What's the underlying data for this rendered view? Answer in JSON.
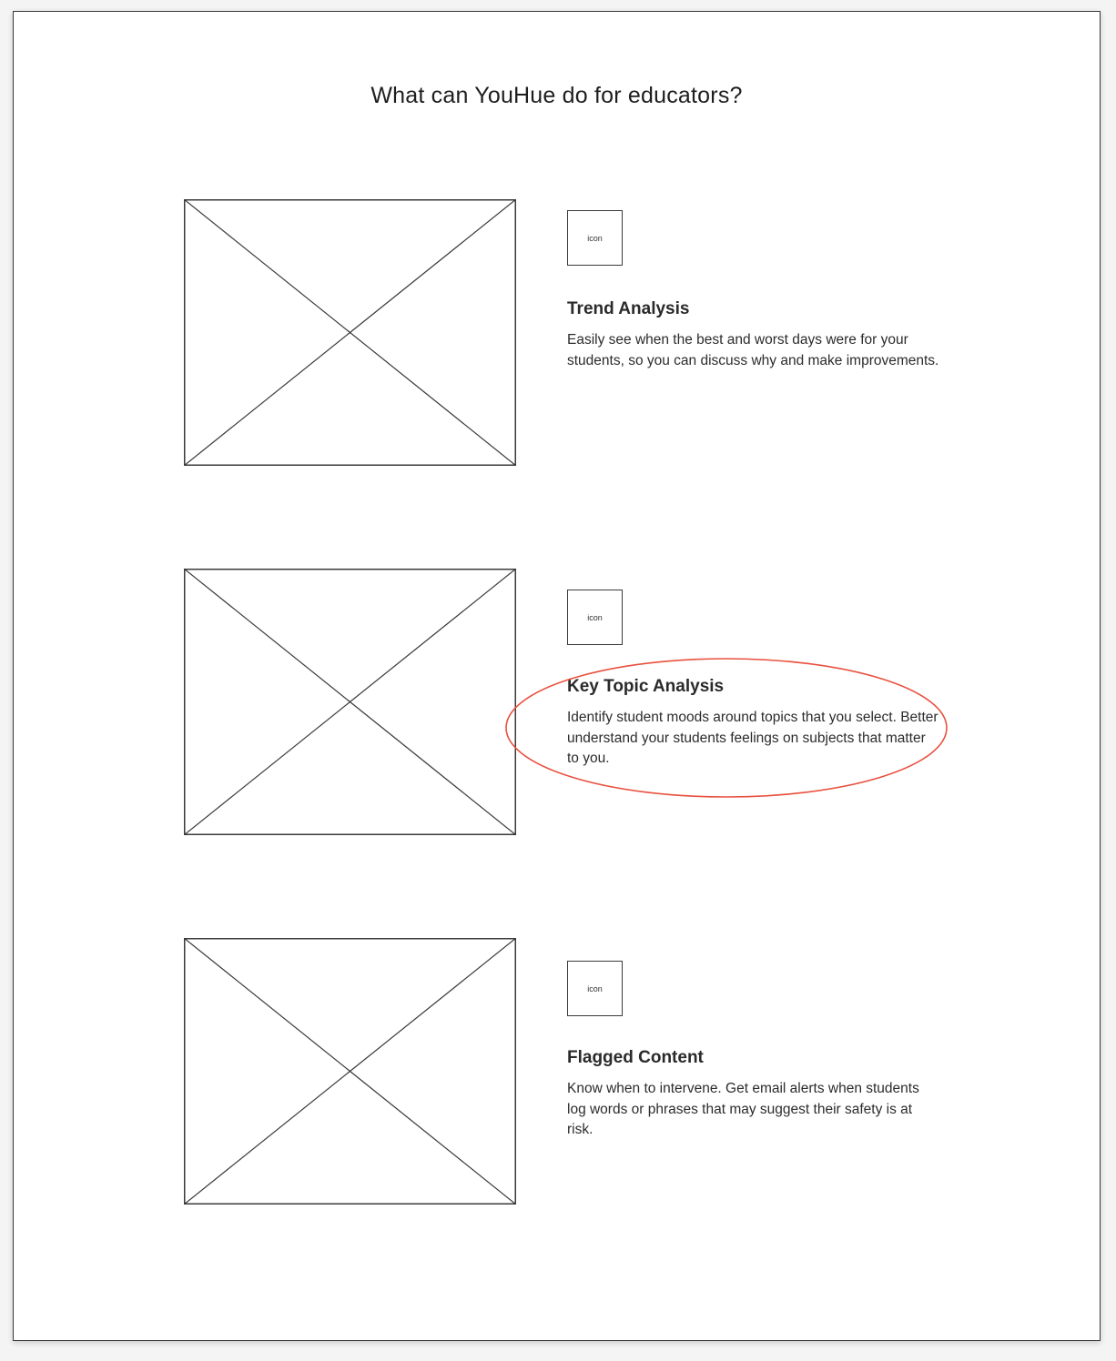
{
  "page": {
    "title": "What can YouHue do for educators?"
  },
  "features": [
    {
      "icon_label": "icon",
      "title": "Trend Analysis",
      "description": "Easily see when the best and worst days were for your students, so you can discuss why and make improvements."
    },
    {
      "icon_label": "icon",
      "title": "Key Topic Analysis",
      "description": "Identify student moods around topics that you select. Better understand your students feelings on subjects that matter to you."
    },
    {
      "icon_label": "icon",
      "title": "Flagged Content",
      "description": "Know when to intervene. Get email alerts when students log words or phrases that may suggest their safety is at risk."
    }
  ],
  "colors": {
    "annotation": "#e8513f",
    "wireframe_stroke": "#3a3a3a"
  }
}
